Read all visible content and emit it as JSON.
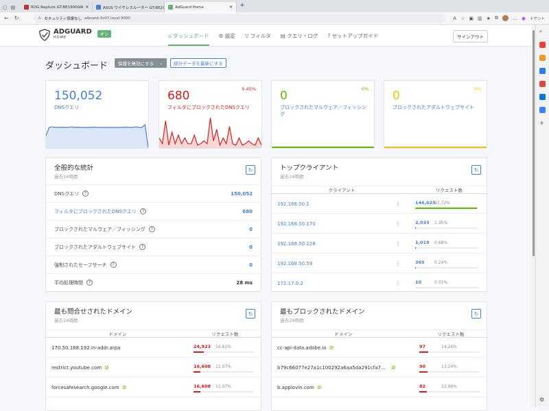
{
  "browser": {
    "tabs": [
      {
        "title": "ROG Rapture GT-BE19000AI"
      },
      {
        "title": "ASUS ワイヤレスルーター GT-BE19000AI"
      },
      {
        "title": "AdGuard Home"
      }
    ],
    "security_label": "セキュリティ保護なし",
    "url": "aiboard-3c07.local:3000",
    "right_label": "ナヤント"
  },
  "header": {
    "brand": "ADGUARD",
    "brand_sub": "HOME",
    "status_badge": "オン",
    "menu": [
      "ダッシュボード",
      "設定",
      "フィルタ",
      "クエリ・ログ",
      "セットアップガイド"
    ],
    "signout": "サインアウト"
  },
  "page": {
    "title": "ダッシュボード",
    "disable_button": "保護を無効にする",
    "refresh_button": "統計データを最新にする"
  },
  "stats_cards": [
    {
      "value": "150,052",
      "label": "DNSクエリ",
      "pct": "",
      "color": "#467fcf"
    },
    {
      "value": "680",
      "label": "フィルタにブロックされたDNSクエリ",
      "pct": "0.45%",
      "color": "#cd201f"
    },
    {
      "value": "0",
      "label": "ブロックされたマルウェア／フィッシング",
      "pct": "0%",
      "color": "#5eba00"
    },
    {
      "value": "0",
      "label": "ブロックされたアダルトウェブサイト",
      "pct": "0%",
      "color": "#f1c40f"
    }
  ],
  "chart_data": [
    {
      "type": "area",
      "series": [
        {
          "values": [
            0,
            0.1,
            0.12,
            0.1,
            0.1,
            0.11,
            0.1,
            0.1,
            0.12,
            0.1,
            0.11,
            0.1,
            0.1,
            0.1,
            0.1,
            0.11,
            0.1,
            0.1,
            0.1,
            0.1,
            0.1,
            0.1,
            0.1,
            0.1,
            0.1,
            0.11,
            0.1,
            0.1,
            0.12,
            0.1,
            0.1,
            0.2,
            1
          ]
        }
      ]
    },
    {
      "type": "area",
      "series": [
        {
          "values": [
            0.3,
            0.1,
            0.9,
            0.05,
            0.5,
            0.1,
            0.4,
            0.1,
            0.3,
            0.1,
            0.1,
            0.4,
            0.05,
            0.1,
            0.2,
            0.1,
            1,
            0.2,
            0.6,
            0.05,
            0.3,
            0.1,
            0.7,
            0.1,
            0.05,
            0.3,
            0.05,
            0.1,
            0.2,
            0.1,
            0.05,
            0.3,
            0.05
          ]
        }
      ]
    },
    {
      "type": "line",
      "series": [
        {
          "values": [
            0,
            0
          ]
        }
      ]
    },
    {
      "type": "line",
      "series": [
        {
          "values": [
            0,
            0
          ]
        }
      ]
    }
  ],
  "general_stats": {
    "title": "全般的な統計",
    "subtitle": "過去24時間",
    "rows": [
      {
        "label": "DNSクエリ",
        "value": "150,052",
        "link": false
      },
      {
        "label": "フィルタにブロックされたDNSクエリ",
        "value": "680",
        "link": true
      },
      {
        "label": "ブロックされたマルウェア／フィッシング",
        "value": "0",
        "link": false
      },
      {
        "label": "ブロックされたアダルトウェブサイト",
        "value": "0",
        "link": false
      },
      {
        "label": "強制されたセーフサーチ",
        "value": "0",
        "link": false
      },
      {
        "label": "平均処理時間",
        "value": "28 ms",
        "link": false,
        "plain": true
      }
    ]
  },
  "top_clients": {
    "title": "トップクライアント",
    "subtitle": "過去24時間",
    "col1": "クライアント",
    "col2": "リクエスト数",
    "rows": [
      {
        "ip": "192.168.50.1",
        "count": "146,625",
        "pct": "97.72%",
        "fill": 0.9772
      },
      {
        "ip": "192.168.50.170",
        "count": "2,033",
        "pct": "1.35%",
        "fill": 0.0135
      },
      {
        "ip": "192.168.50.228",
        "count": "1,019",
        "pct": "0.68%",
        "fill": 0.0068
      },
      {
        "ip": "192.168.50.59",
        "count": "365",
        "pct": "0.24%",
        "fill": 0.0024
      },
      {
        "ip": "172.17.0.2",
        "count": "10",
        "pct": "0.01%",
        "fill": 0.0001
      }
    ]
  },
  "top_domains": {
    "title": "最も問合せされたドメイン",
    "subtitle": "過去24時間",
    "col1": "ドメイン",
    "col2": "リクエスト数",
    "rows": [
      {
        "domain": "170.50.168.192.in-addr.arpa",
        "count": "24,923",
        "pct": "16.61%",
        "fill": 0.1661,
        "eye": false
      },
      {
        "domain": "restrict.youtube.com",
        "count": "16,608",
        "pct": "11.07%",
        "fill": 0.1107,
        "eye": true
      },
      {
        "domain": "forcesafesearch.google.com",
        "count": "16,608",
        "pct": "11.07%",
        "fill": 0.1107,
        "eye": true
      }
    ]
  },
  "top_blocked": {
    "title": "最もブロックされたドメイン",
    "subtitle": "過去24時間",
    "col1": "ドメイン",
    "col2": "リクエスト数",
    "rows": [
      {
        "domain": "cc-api-data.adobe.io",
        "count": "97",
        "pct": "14.26%",
        "fill": 0.1426,
        "eye": true
      },
      {
        "domain": "b79c66077e27a1c100292a6aa5da291cfa7d...",
        "count": "90",
        "pct": "13.24%",
        "fill": 0.1324,
        "eye": true
      },
      {
        "domain": "b.applovin.com",
        "count": "82",
        "pct": "12.06%",
        "fill": 0.1206,
        "eye": true
      }
    ]
  }
}
